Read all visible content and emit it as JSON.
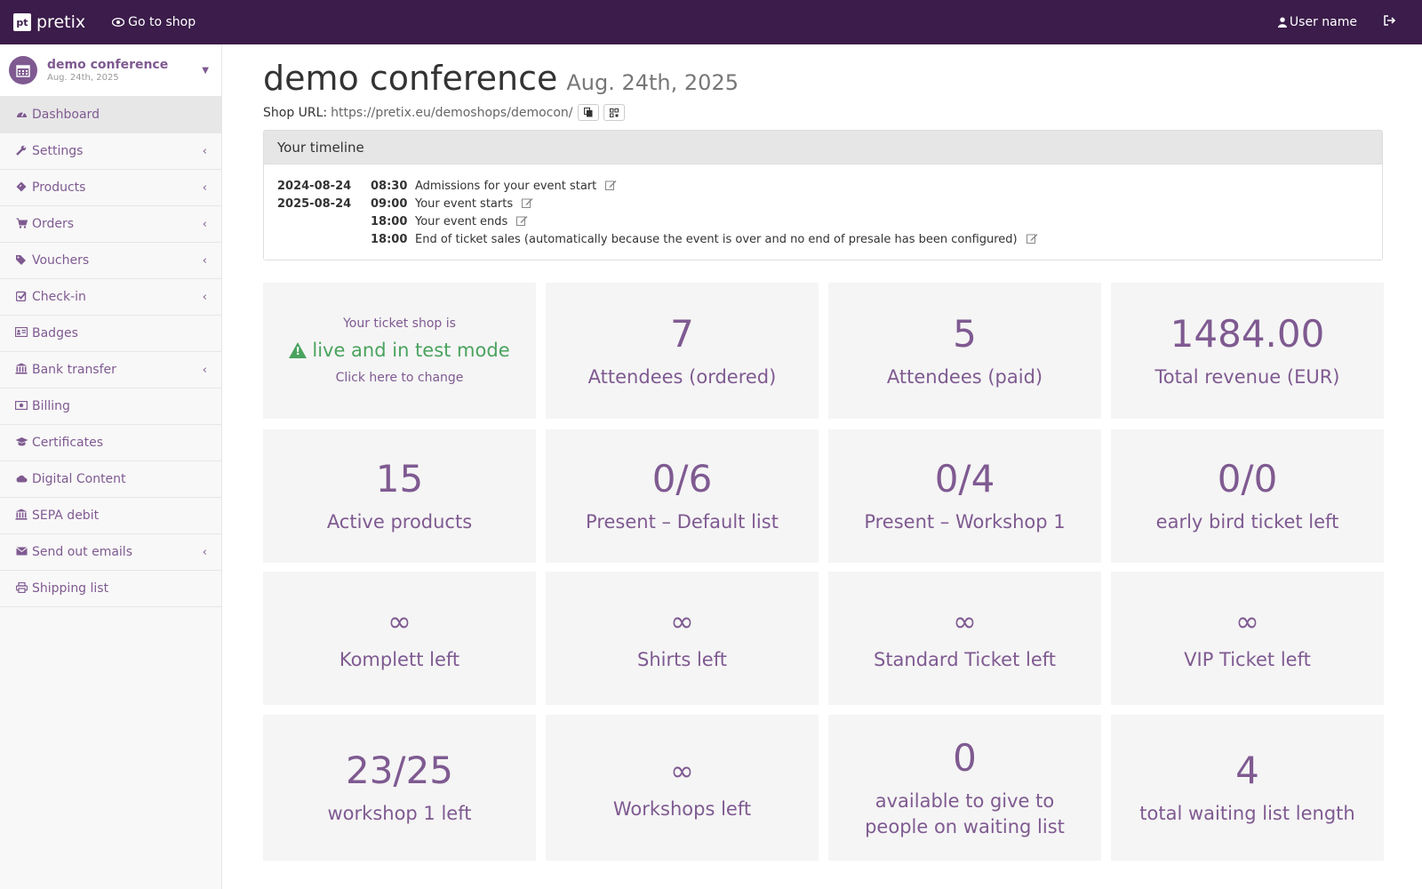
{
  "topbar": {
    "brand_logo": "pt",
    "brand_name": "pretix",
    "goto_shop": "Go to shop",
    "user_name": "User name"
  },
  "sidebar": {
    "event_name": "demo conference",
    "event_date": "Aug. 24th, 2025",
    "items": [
      {
        "label": "Dashboard",
        "icon": "dashboard-icon",
        "chevron": false,
        "active": true
      },
      {
        "label": "Settings",
        "icon": "wrench-icon",
        "chevron": true
      },
      {
        "label": "Products",
        "icon": "ticket-icon",
        "chevron": true
      },
      {
        "label": "Orders",
        "icon": "cart-icon",
        "chevron": true
      },
      {
        "label": "Vouchers",
        "icon": "tags-icon",
        "chevron": true
      },
      {
        "label": "Check-in",
        "icon": "check-square-icon",
        "chevron": true
      },
      {
        "label": "Badges",
        "icon": "id-card-icon",
        "chevron": false
      },
      {
        "label": "Bank transfer",
        "icon": "bank-icon",
        "chevron": true
      },
      {
        "label": "Billing",
        "icon": "money-icon",
        "chevron": false
      },
      {
        "label": "Certificates",
        "icon": "graduation-cap-icon",
        "chevron": false
      },
      {
        "label": "Digital Content",
        "icon": "cloud-icon",
        "chevron": false
      },
      {
        "label": "SEPA debit",
        "icon": "bank-icon",
        "chevron": false
      },
      {
        "label": "Send out emails",
        "icon": "envelope-icon",
        "chevron": true
      },
      {
        "label": "Shipping list",
        "icon": "print-icon",
        "chevron": false
      }
    ]
  },
  "main": {
    "title": "demo conference",
    "title_date": "Aug. 24th, 2025",
    "shop_url_label": "Shop URL:",
    "shop_url": "https://pretix.eu/demoshops/democon/"
  },
  "timeline": {
    "heading": "Your timeline",
    "rows": [
      {
        "date": "2024-08-24",
        "time": "08:30",
        "desc": "Admissions for your event start"
      },
      {
        "date": "2025-08-24",
        "time": "09:00",
        "desc": "Your event starts"
      },
      {
        "date": "",
        "time": "18:00",
        "desc": "Your event ends"
      },
      {
        "date": "",
        "time": "18:00",
        "desc": "End of ticket sales (automatically because the event is over and no end of presale has been configured)"
      }
    ]
  },
  "shop_status": {
    "line1": "Your ticket shop is",
    "status": "live and in test mode",
    "change": "Click here to change",
    "color": "#4aa35e"
  },
  "tiles": {
    "attendees_ordered": {
      "value": "7",
      "label": "Attendees (ordered)"
    },
    "attendees_paid": {
      "value": "5",
      "label": "Attendees (paid)"
    },
    "total_revenue": {
      "value": "1484.00",
      "label": "Total revenue (EUR)"
    },
    "active_products": {
      "value": "15",
      "label": "Active products"
    },
    "present_default": {
      "value": "0/6",
      "label": "Present – Default list"
    },
    "present_workshop": {
      "value": "0/4",
      "label": "Present – Workshop 1"
    },
    "early_bird": {
      "value": "0/0",
      "label": "early bird ticket left"
    },
    "komplett": {
      "value": "∞",
      "label": "Komplett left"
    },
    "shirts": {
      "value": "∞",
      "label": "Shirts left"
    },
    "standard_ticket": {
      "value": "∞",
      "label": "Standard Ticket left"
    },
    "vip_ticket": {
      "value": "∞",
      "label": "VIP Ticket left"
    },
    "workshop1": {
      "value": "23/25",
      "label": "workshop 1 left"
    },
    "workshops": {
      "value": "∞",
      "label": "Workshops left"
    },
    "waiting_available": {
      "value": "0",
      "label": "available to give to people on waiting list"
    },
    "waiting_total": {
      "value": "4",
      "label": "total waiting list length"
    }
  },
  "colors": {
    "topbar": "#3b1c4a",
    "accent": "#7f5a91",
    "success": "#4aa35e"
  }
}
